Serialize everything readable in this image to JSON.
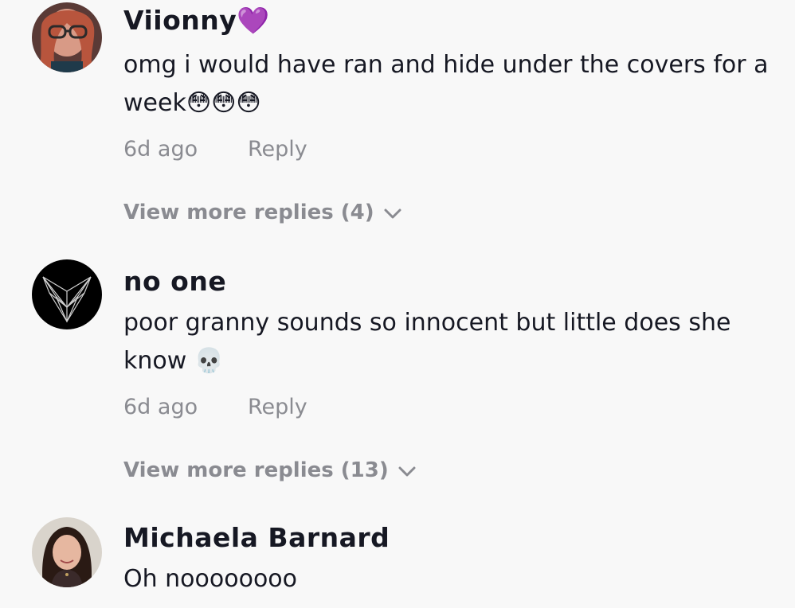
{
  "comments": [
    {
      "username": "Viionny",
      "badge": "💜",
      "text": "omg i would have ran and hide under the covers for a week😳😳😳",
      "time": "6d ago",
      "reply_label": "Reply",
      "more_replies": "View more replies (4)"
    },
    {
      "username": "no one",
      "text": "poor granny sounds so innocent but little does she know 💀",
      "time": "6d ago",
      "reply_label": "Reply",
      "more_replies": "View more replies (13)"
    },
    {
      "username": "Michaela Barnard",
      "text": "Oh noooooooo"
    }
  ],
  "icons": {
    "chevron": "chevron-down-icon"
  },
  "colors": {
    "background": "#f8f8f8",
    "primary_text": "#161823",
    "secondary_text": "#8a8b91"
  }
}
